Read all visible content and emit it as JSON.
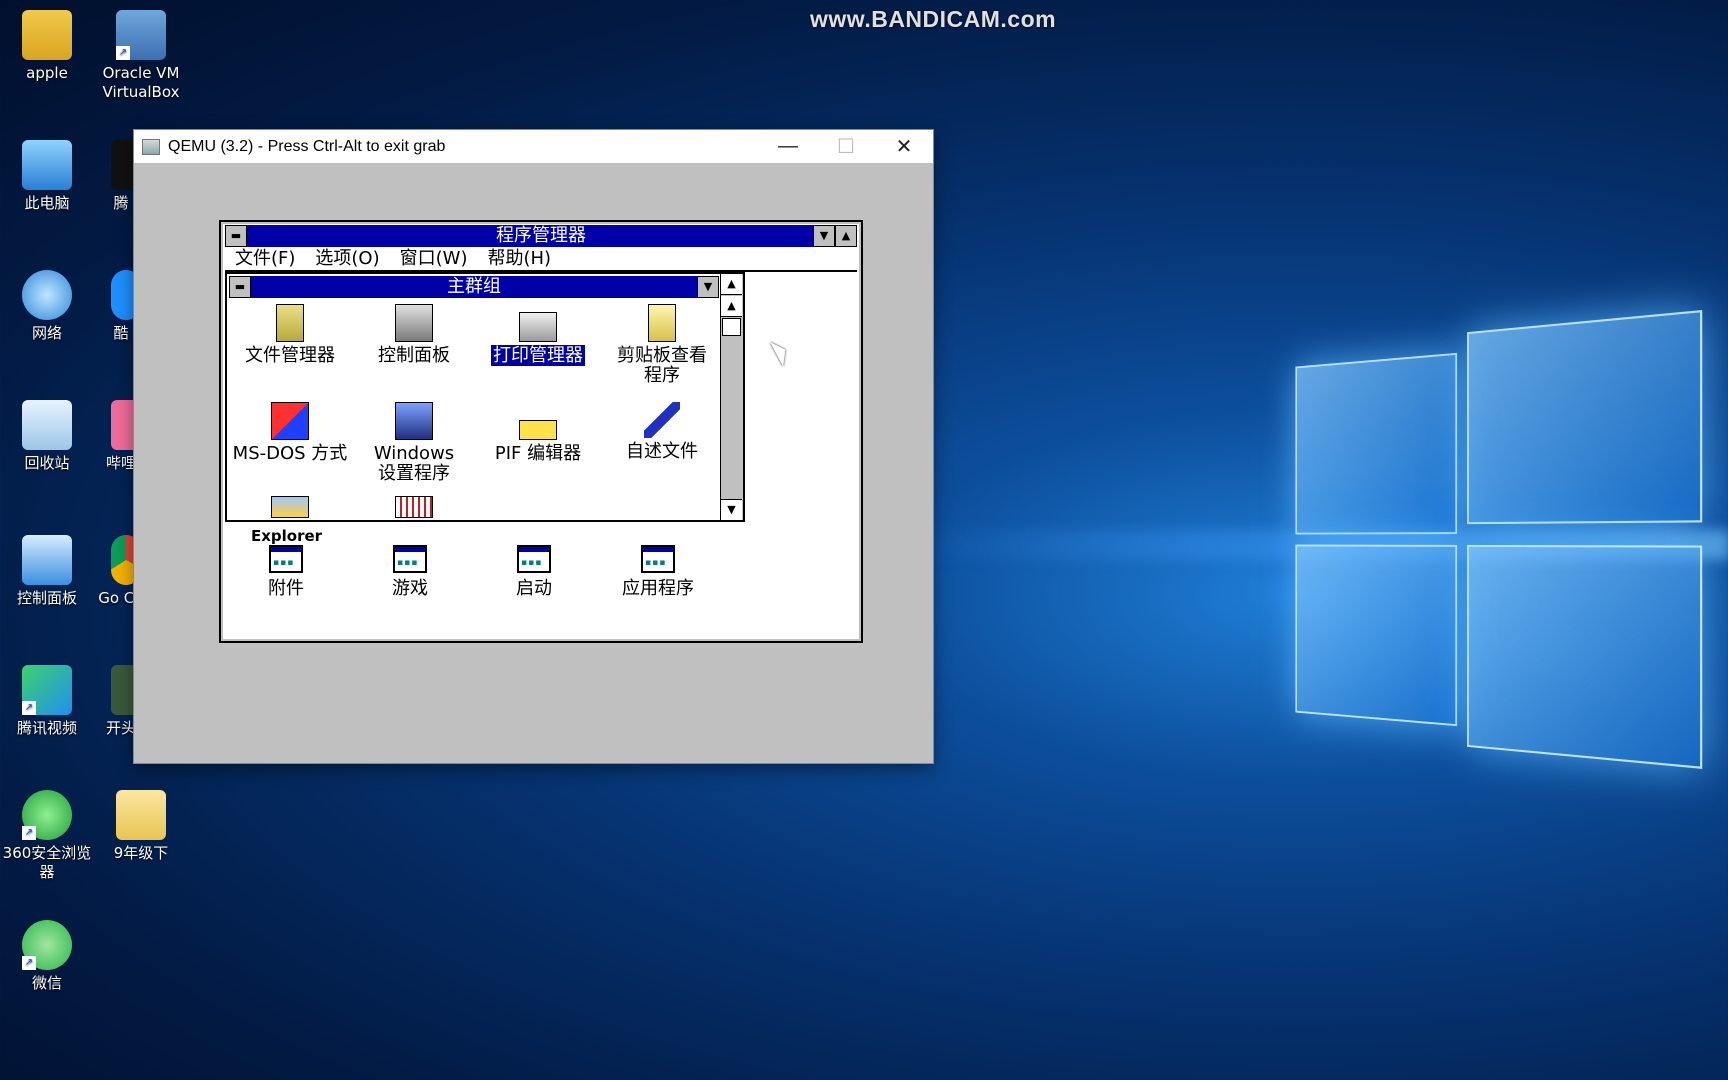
{
  "watermark": "www.BANDICAM.com",
  "desktop": {
    "icons": [
      {
        "label": "apple"
      },
      {
        "label": "Oracle VM VirtualBox"
      },
      {
        "label": "此电脑"
      },
      {
        "label": "腾"
      },
      {
        "label": "网络"
      },
      {
        "label": "酷"
      },
      {
        "label": "回收站"
      },
      {
        "label": "哔哩"
      },
      {
        "label": "控制面板"
      },
      {
        "label": "Go Ch"
      },
      {
        "label": "腾讯视频"
      },
      {
        "label": "开头"
      },
      {
        "label": "360安全浏览器"
      },
      {
        "label": "9年级下"
      },
      {
        "label": "微信"
      }
    ]
  },
  "qemu": {
    "title": "QEMU (3.2) - Press Ctrl-Alt to exit grab",
    "minimize": "—",
    "maximize": "☐",
    "close": "✕"
  },
  "progman": {
    "title": "程序管理器",
    "menu": [
      "文件(F)",
      "选项(O)",
      "窗口(W)",
      "帮助(H)"
    ],
    "main_group": {
      "title": "主群组",
      "items": [
        {
          "label": "文件管理器",
          "icon": "file-cabinet-icon",
          "selected": false
        },
        {
          "label": "控制面板",
          "icon": "control-panel-icon",
          "selected": false
        },
        {
          "label": "打印管理器",
          "icon": "printer-icon",
          "selected": true
        },
        {
          "label": "剪贴板查看程序",
          "icon": "clipboard-icon",
          "selected": false
        },
        {
          "label": "MS-DOS 方式",
          "icon": "msdos-icon",
          "selected": false
        },
        {
          "label": "Windows 设置程序",
          "icon": "windows-setup-icon",
          "selected": false
        },
        {
          "label": "PIF 编辑器",
          "icon": "pif-tag-icon",
          "selected": false
        },
        {
          "label": "自述文件",
          "icon": "readme-pen-icon",
          "selected": false
        }
      ],
      "partial_label": "Explorer"
    },
    "groups": [
      "附件",
      "游戏",
      "启动",
      "应用程序"
    ]
  },
  "colors": {
    "win31_titlebar": "#0000a8",
    "win31_face": "#c0c0c0"
  }
}
